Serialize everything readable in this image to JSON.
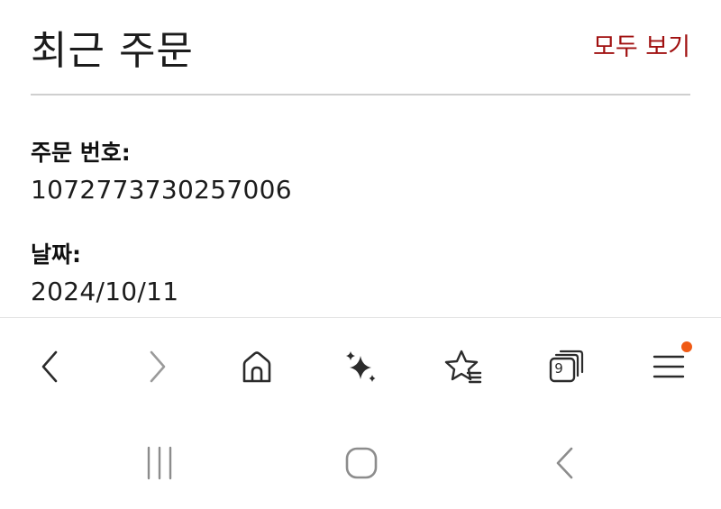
{
  "header": {
    "title": "최근 주문",
    "view_all_label": "모두 보기"
  },
  "order": {
    "number_label": "주문 번호:",
    "number_value": "1072773730257006",
    "date_label": "날짜:",
    "date_value": "2024/10/11"
  },
  "toolbar": {
    "items": [
      {
        "icon": "back-icon",
        "enabled": true
      },
      {
        "icon": "forward-icon",
        "enabled": false
      },
      {
        "icon": "home-icon",
        "enabled": true
      },
      {
        "icon": "sparkle-icon",
        "enabled": true
      },
      {
        "icon": "bookmarks-icon",
        "enabled": true
      },
      {
        "icon": "tabs-icon",
        "enabled": true
      },
      {
        "icon": "menu-icon",
        "enabled": true
      }
    ],
    "tab_count": "9",
    "notification_color": "#f05a14"
  },
  "navbar": {
    "items": [
      "recent-apps-icon",
      "home-button-icon",
      "back-nav-icon"
    ]
  },
  "colors": {
    "accent": "#a01010",
    "divider": "#cfcfcf",
    "icon": "#2b2b2b",
    "disabled_icon": "#9a9a9a"
  }
}
